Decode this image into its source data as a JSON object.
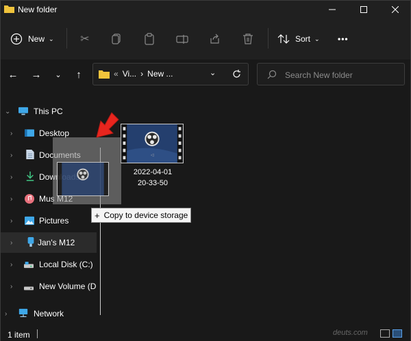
{
  "window": {
    "title": "New folder"
  },
  "toolbar": {
    "new_label": "New",
    "sort_label": "Sort",
    "more_label": "•••"
  },
  "address": {
    "crumbs": [
      "«",
      "Vi...",
      "›",
      "New ..."
    ],
    "search_placeholder": "Search New folder"
  },
  "navpane": {
    "items": [
      {
        "label": "This PC",
        "icon": "monitor-icon"
      },
      {
        "label": "Desktop",
        "icon": "desktop-icon"
      },
      {
        "label": "Documents",
        "icon": "documents-icon"
      },
      {
        "label": "Downloads",
        "icon": "download-icon"
      },
      {
        "label": "Mus M12",
        "icon": "music-icon"
      },
      {
        "label": "Pictures",
        "icon": "pictures-icon"
      },
      {
        "label": "Jan's M12",
        "icon": "phone-icon"
      },
      {
        "label": "Local Disk (C:)",
        "icon": "disk-icon"
      },
      {
        "label": "New Volume (D",
        "icon": "drive-icon"
      },
      {
        "label": "Network",
        "icon": "network-icon"
      }
    ]
  },
  "file": {
    "name_line1": "2022-04-01",
    "name_line2": "20-33-50"
  },
  "tooltip": {
    "plus": "+",
    "text": "Copy to device storage"
  },
  "status": {
    "count": "1 item"
  },
  "watermark": {
    "text": "deuts.com"
  },
  "colors": {
    "accent": "#5aa0e8",
    "arrow": "#e8251e",
    "folder": "#f0c33c"
  }
}
